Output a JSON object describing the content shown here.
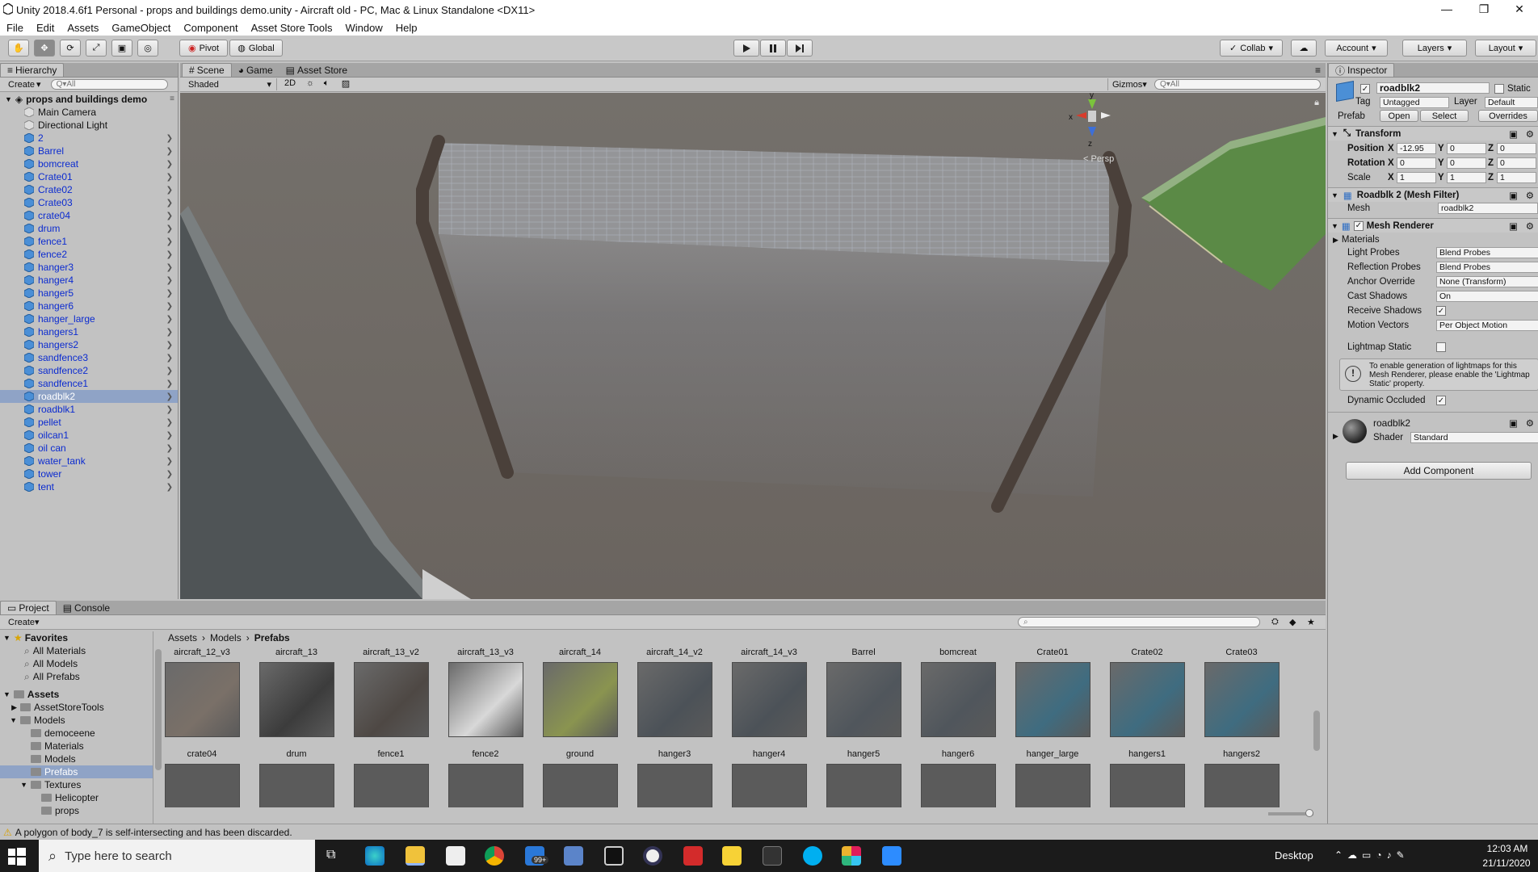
{
  "window": {
    "title": "Unity 2018.4.6f1 Personal - props and buildings demo.unity - Aircraft old - PC, Mac & Linux Standalone <DX11>",
    "minimize": "—",
    "maximize": "❐",
    "close": "✕"
  },
  "menu": [
    "File",
    "Edit",
    "Assets",
    "GameObject",
    "Component",
    "Asset Store Tools",
    "Window",
    "Help"
  ],
  "toolbar": {
    "pivot": "Pivot",
    "global": "Global",
    "collab": "Collab",
    "account": "Account",
    "layers": "Layers",
    "layout": "Layout"
  },
  "hierarchy": {
    "tab": "Hierarchy",
    "create": "Create",
    "search_placeholder": "Q▾All",
    "scene": "props and buildings demo",
    "items": [
      {
        "label": "Main Camera",
        "kind": "go",
        "arrow": false
      },
      {
        "label": "Directional Light",
        "kind": "go",
        "arrow": false
      },
      {
        "label": "2",
        "kind": "prefab",
        "arrow": true
      },
      {
        "label": "Barrel",
        "kind": "prefab",
        "arrow": true
      },
      {
        "label": "bomcreat",
        "kind": "prefab",
        "arrow": true
      },
      {
        "label": "Crate01",
        "kind": "prefab",
        "arrow": true
      },
      {
        "label": "Crate02",
        "kind": "prefab",
        "arrow": true
      },
      {
        "label": "Crate03",
        "kind": "prefab",
        "arrow": true
      },
      {
        "label": "crate04",
        "kind": "prefab",
        "arrow": true
      },
      {
        "label": "drum",
        "kind": "prefab",
        "arrow": true
      },
      {
        "label": "fence1",
        "kind": "prefab",
        "arrow": true
      },
      {
        "label": "fence2",
        "kind": "prefab",
        "arrow": true
      },
      {
        "label": "hanger3",
        "kind": "prefab",
        "arrow": true
      },
      {
        "label": "hanger4",
        "kind": "prefab",
        "arrow": true
      },
      {
        "label": "hanger5",
        "kind": "prefab",
        "arrow": true
      },
      {
        "label": "hanger6",
        "kind": "prefab",
        "arrow": true
      },
      {
        "label": "hanger_large",
        "kind": "prefab",
        "arrow": true
      },
      {
        "label": "hangers1",
        "kind": "prefab",
        "arrow": true
      },
      {
        "label": "hangers2",
        "kind": "prefab",
        "arrow": true
      },
      {
        "label": "sandfence3",
        "kind": "prefab",
        "arrow": true
      },
      {
        "label": "sandfence2",
        "kind": "prefab",
        "arrow": true
      },
      {
        "label": "sandfence1",
        "kind": "prefab",
        "arrow": true
      },
      {
        "label": "roadblk2",
        "kind": "prefab",
        "arrow": true,
        "selected": true
      },
      {
        "label": "roadblk1",
        "kind": "prefab",
        "arrow": true
      },
      {
        "label": "pellet",
        "kind": "prefab",
        "arrow": true
      },
      {
        "label": "oilcan1",
        "kind": "prefab",
        "arrow": true
      },
      {
        "label": "oil can",
        "kind": "prefab",
        "arrow": true
      },
      {
        "label": "water_tank",
        "kind": "prefab",
        "arrow": true
      },
      {
        "label": "tower",
        "kind": "prefab",
        "arrow": true
      },
      {
        "label": "tent",
        "kind": "prefab",
        "arrow": true
      }
    ]
  },
  "scene": {
    "tabs": [
      "Scene",
      "Game",
      "Asset Store"
    ],
    "shading": "Shaded",
    "mode2d": "2D",
    "gizmos": "Gizmos",
    "search_placeholder": "Q▾All",
    "persp": "< Persp"
  },
  "inspector": {
    "tab": "Inspector",
    "name": "roadblk2",
    "static": "Static",
    "tag_label": "Tag",
    "tag": "Untagged",
    "layer_label": "Layer",
    "layer": "Default",
    "prefab_label": "Prefab",
    "open": "Open",
    "select": "Select",
    "overrides": "Overrides",
    "transform": {
      "title": "Transform",
      "position_label": "Position",
      "rotation_label": "Rotation",
      "scale_label": "Scale",
      "position": [
        "-12.95",
        "0",
        "0"
      ],
      "rotation": [
        "0",
        "0",
        "0"
      ],
      "scale": [
        "1",
        "1",
        "1"
      ]
    },
    "meshfilter": {
      "title": "Roadblk 2 (Mesh Filter)",
      "mesh_label": "Mesh",
      "mesh": "roadblk2"
    },
    "meshrenderer": {
      "title": "Mesh Renderer",
      "materials": "Materials",
      "light_probes_label": "Light Probes",
      "light_probes": "Blend Probes",
      "reflection_probes_label": "Reflection Probes",
      "reflection_probes": "Blend Probes",
      "anchor_label": "Anchor Override",
      "anchor": "None (Transform)",
      "cast_label": "Cast Shadows",
      "cast": "On",
      "receive_label": "Receive Shadows",
      "motion_label": "Motion Vectors",
      "motion": "Per Object Motion",
      "lightmap_label": "Lightmap Static",
      "info": "To enable generation of lightmaps for this Mesh Renderer, please enable the 'Lightmap Static' property.",
      "dynamic_label": "Dynamic Occluded"
    },
    "material": {
      "name": "roadblk2",
      "shader_label": "Shader",
      "shader": "Standard"
    },
    "add_component": "Add Component"
  },
  "project": {
    "tabs": [
      "Project",
      "Console"
    ],
    "create": "Create",
    "breadcrumb": [
      "Assets",
      "Models",
      "Prefabs"
    ],
    "favorites": {
      "label": "Favorites",
      "items": [
        "All Materials",
        "All Models",
        "All Prefabs"
      ]
    },
    "assets": {
      "label": "Assets",
      "items": [
        {
          "label": "AssetStoreTools",
          "depth": 1,
          "arrow": "▶"
        },
        {
          "label": "Models",
          "depth": 1,
          "arrow": "▼"
        },
        {
          "label": "democeene",
          "depth": 2,
          "arrow": ""
        },
        {
          "label": "Materials",
          "depth": 2,
          "arrow": ""
        },
        {
          "label": "Models",
          "depth": 2,
          "arrow": ""
        },
        {
          "label": "Prefabs",
          "depth": 2,
          "arrow": "",
          "selected": true
        },
        {
          "label": "Textures",
          "depth": 2,
          "arrow": "▼"
        },
        {
          "label": "Helicopter",
          "depth": 3,
          "arrow": ""
        },
        {
          "label": "props",
          "depth": 3,
          "arrow": ""
        }
      ]
    },
    "top_labels": [
      "aircraft_12_v3",
      "aircraft_13",
      "aircraft_13_v2",
      "aircraft_13_v3",
      "aircraft_14",
      "aircraft_14_v2",
      "aircraft_14_v3",
      "Barrel",
      "bomcreat",
      "Crate01",
      "Crate02",
      "Crate03"
    ],
    "row_labels": [
      "crate04",
      "drum",
      "fence1",
      "fence2",
      "ground",
      "hanger3",
      "hanger4",
      "hanger5",
      "hanger6",
      "hanger_large",
      "hangers1",
      "hangers2"
    ]
  },
  "status": {
    "message": "A polygon of body_7 is self-intersecting and has been discarded."
  },
  "taskbar": {
    "search": "Type here to search",
    "desktop": "Desktop",
    "time": "12:03 AM",
    "date": "21/11/2020",
    "badge": "99+"
  },
  "colors": {
    "selection": "#8fa3c6",
    "prefab_text": "#0b2bd0",
    "viewport": "#6e6a65"
  }
}
